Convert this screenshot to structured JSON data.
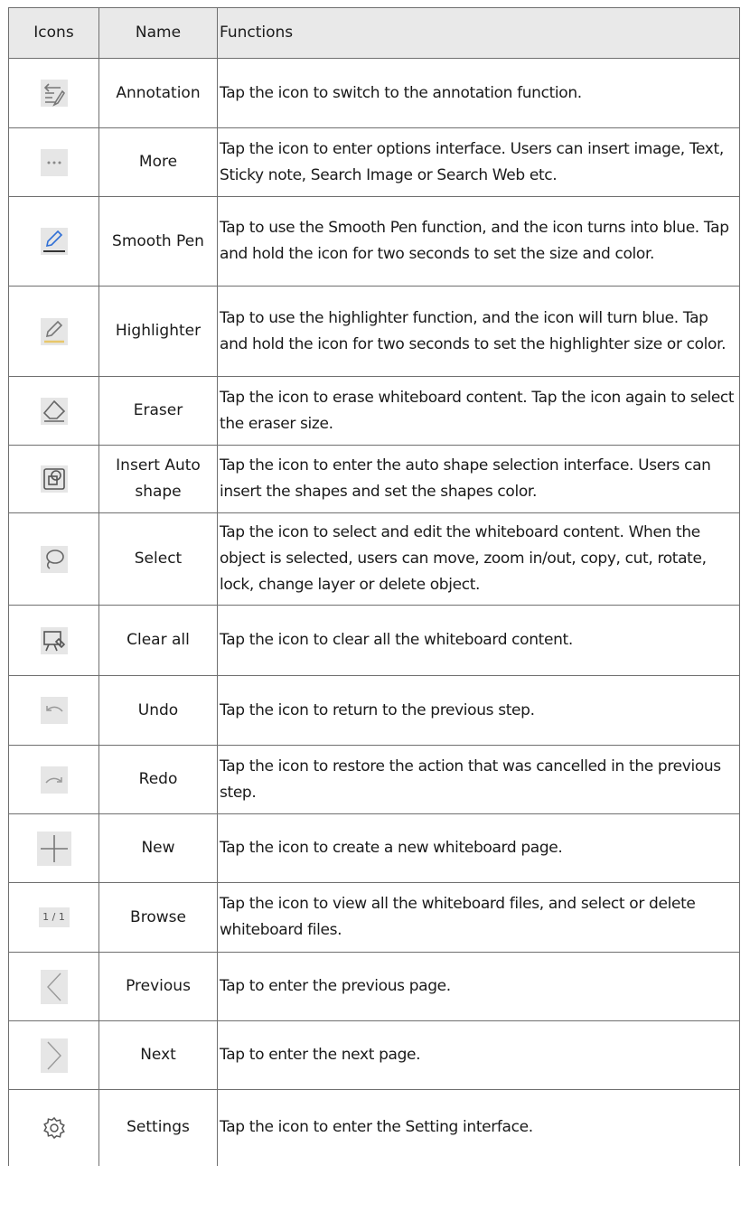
{
  "header": {
    "icons": "Icons",
    "name": "Name",
    "functions": "Functions"
  },
  "rows": [
    {
      "icon": "annotation-icon",
      "name": "Annotation",
      "function": "Tap the icon to switch to the annotation function."
    },
    {
      "icon": "more-icon",
      "name": "More",
      "function": "Tap the icon to enter options interface. Users can insert image, Text, Sticky note, Search Image or Search Web etc."
    },
    {
      "icon": "smooth-pen-icon",
      "name": "Smooth Pen",
      "function": "Tap to use the Smooth Pen function, and the icon turns into blue. Tap and hold the icon for two seconds to set the size and color."
    },
    {
      "icon": "highlighter-icon",
      "name": "Highlighter",
      "function": "Tap to use the highlighter function, and the icon will turn blue. Tap and hold the icon for two seconds to set the highlighter size or color."
    },
    {
      "icon": "eraser-icon",
      "name": "Eraser",
      "function": "Tap the icon to erase whiteboard content. Tap the icon again to select the eraser size."
    },
    {
      "icon": "auto-shape-icon",
      "name": "Insert Auto shape",
      "function": "Tap the icon to enter the auto shape selection interface. Users can insert the shapes and set the shapes color."
    },
    {
      "icon": "lasso-select-icon",
      "name": "Select",
      "function": "Tap the icon to select and edit the whiteboard content. When the object is selected, users can move, zoom in/out, copy, cut, rotate, lock, change layer or delete object."
    },
    {
      "icon": "clear-all-icon",
      "name": "Clear all",
      "function": "Tap the icon to clear all the whiteboard content."
    },
    {
      "icon": "undo-icon",
      "name": "Undo",
      "function": "Tap the icon to return to the previous step."
    },
    {
      "icon": "redo-icon",
      "name": "Redo",
      "function": "Tap the icon to restore the action that was cancelled in the previous step."
    },
    {
      "icon": "plus-icon",
      "name": "New",
      "function": "Tap the icon to create a new whiteboard page."
    },
    {
      "icon": "page-counter-icon",
      "name": "Browse",
      "function": "Tap the icon to view all the whiteboard files, and select or delete whiteboard files.",
      "icon_text": "1 / 1"
    },
    {
      "icon": "chevron-left-icon",
      "name": "Previous",
      "function": "Tap to enter the previous page."
    },
    {
      "icon": "chevron-right-icon",
      "name": "Next",
      "function": "Tap to enter the next page."
    },
    {
      "icon": "gear-icon",
      "name": "Settings",
      "function": "Tap the icon to enter the Setting interface."
    }
  ],
  "colors": {
    "pen_blue": "#2f6fd6",
    "highlight_yellow": "#e8c76a",
    "icon_gray": "#777777"
  }
}
